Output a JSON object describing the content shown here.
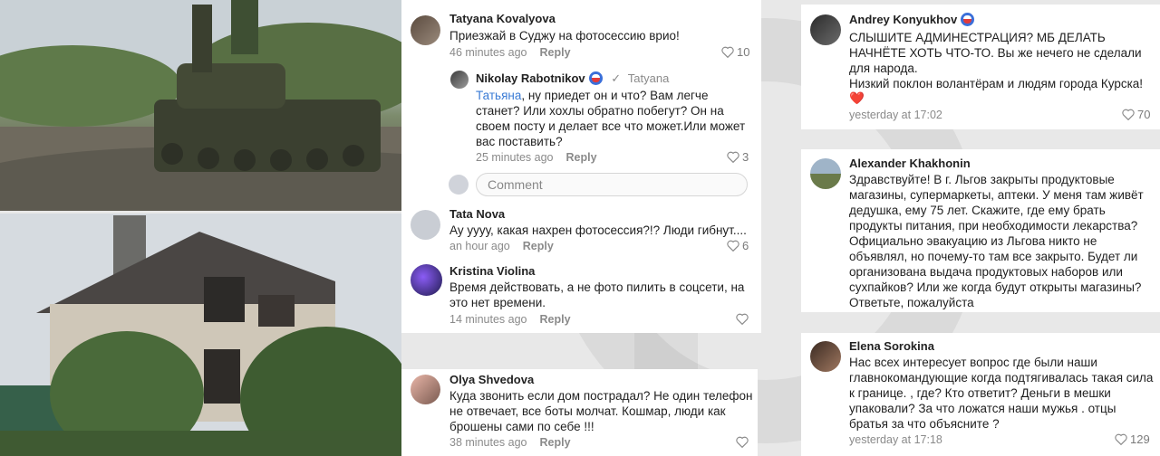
{
  "left_column": {
    "comments": [
      {
        "author": "Tatyana Kovalyova",
        "text": "Приезжай в Суджу на фотосессию врио!",
        "time": "46 minutes ago",
        "reply_label": "Reply",
        "likes": "10"
      },
      {
        "author": "Nikolay Rabotnikov",
        "reply_to": "Tatyana",
        "mention": "Татьяна",
        "text": ", ну приедет он и что? Вам легче станет? Или хохлы обратно побегут? Он на своем посту и делает все что может.Или может вас поставить?",
        "time": "25 minutes ago",
        "reply_label": "Reply",
        "likes": "3"
      },
      {
        "comment_placeholder": "Comment"
      },
      {
        "author": "Tata Nova",
        "text": "Ау уууу, какая нахрен фотосессия?!? Люди гибнут....",
        "time": "an hour ago",
        "reply_label": "Reply",
        "likes": "6"
      },
      {
        "author": "Kristina Violina",
        "text": "Время действовать, а не фото пилить в соцсети, на это нет времени.",
        "time": "14 minutes ago",
        "reply_label": "Reply",
        "likes": ""
      },
      {
        "author": "Olya Shvedova",
        "text": "Куда звонить если дом пострадал? Не один телефон не отвечает, все боты молчат. Кошмар, люди как брошены сами по себе !!!",
        "time": "38 minutes ago",
        "reply_label": "Reply",
        "likes": ""
      }
    ]
  },
  "right_column": {
    "comments": [
      {
        "author": "Andrey Konyukhov",
        "text": "СЛЫШИТЕ АДМИНЕСТРАЦИЯ? МБ ДЕЛАТЬ НАЧНЁТЕ ХОТЬ ЧТО-ТО. Вы же нечего не сделали для народа.",
        "text2": "Низкий поклон волантёрам и людям города Курска!",
        "emoji": "❤️",
        "time": "yesterday at 17:02",
        "likes": "70"
      },
      {
        "author": "Alexander Khakhonin",
        "text": "Здравствуйте! В г. Льгов закрыты продуктовые магазины, супермаркеты, аптеки. У меня там живёт дедушка, ему 75 лет. Скажите, где ему брать продукты питания, при необходимости лекарства? Официально эвакуацию из Льгова никто не объявлял, но почему-то там все закрыто. Будет ли организована выдача продуктовых наборов или сухпайков? Или же когда будут открыты магазины? Ответьте, пожалуйста"
      },
      {
        "author": "Elena Sorokina",
        "text": "Нас всех интересует вопрос где были наши главнокомандующие когда подтягивалась такая сила к границе. , где? Кто ответит? Деньги в мешки упаковали? За что ложатся наши мужья . отцы братья за что объясните ?",
        "time": "yesterday at 17:18",
        "likes": "129"
      }
    ]
  }
}
